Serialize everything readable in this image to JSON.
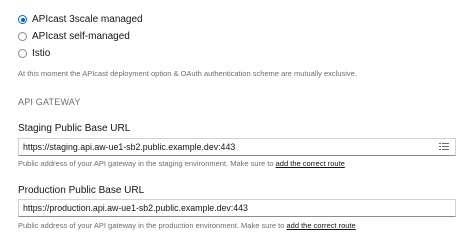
{
  "deployment_options": [
    {
      "label": "APIcast 3scale managed",
      "checked": true
    },
    {
      "label": "APIcast self-managed",
      "checked": false
    },
    {
      "label": "Istio",
      "checked": false
    }
  ],
  "deployment_note": "At this moment the APIcast deployment option & OAuth authentication scheme are mutually exclusive.",
  "api_gateway": {
    "heading": "API GATEWAY",
    "staging": {
      "label": "Staging Public Base URL",
      "value": "https://staging.api.aw-ue1-sb2.public.example.dev:443",
      "help_text": "Public address of your API gateway in the staging environment. Make sure to ",
      "help_link": "add the correct route",
      "icon": "list-icon"
    },
    "production": {
      "label": "Production Public Base URL",
      "value": "https://production.api.aw-ue1-sb2.public.example.dev:443",
      "help_text": "Public address of your API gateway in the production environment. Make sure to ",
      "help_link": "add the correct route"
    }
  },
  "colors": {
    "accent": "#0066cc",
    "muted_text": "#6a6e73",
    "border": "#d2d2d2"
  }
}
